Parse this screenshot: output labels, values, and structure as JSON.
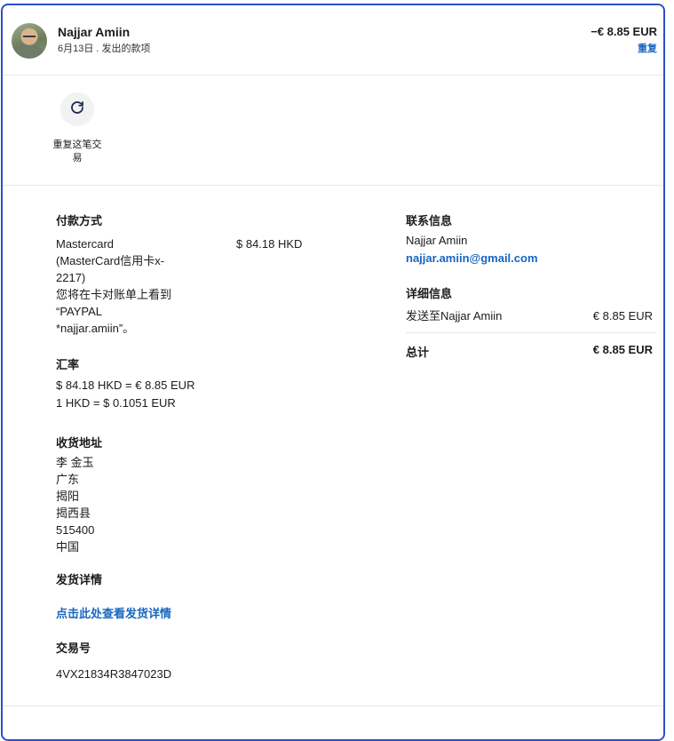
{
  "header": {
    "name": "Najjar Amiin",
    "subtitle": "6月13日 . 发出的款项",
    "amount": "−€ 8.85 EUR",
    "repeat_link": "重复"
  },
  "action": {
    "icon": "refresh-icon",
    "label": "重复这笔交易"
  },
  "payment": {
    "title": "付款方式",
    "method_lines": [
      "Mastercard",
      "(MasterCard信用卡x-",
      "2217)",
      "您将在卡对账单上看到",
      "“PAYPAL",
      "*najjar.amiin”。"
    ],
    "amount": "$ 84.18 HKD"
  },
  "exchange": {
    "title": "汇率",
    "line1": "$ 84.18 HKD = € 8.85 EUR",
    "line2": "1 HKD = $ 0.1051 EUR"
  },
  "shipping_address": {
    "title": "收货地址",
    "lines": [
      "李 金玉",
      "广东",
      "揭阳",
      "揭西县",
      "515400",
      "中国"
    ]
  },
  "shipping_details": {
    "title": "发货详情",
    "link": "点击此处查看发货详情"
  },
  "transaction": {
    "title": "交易号",
    "id": "4VX21834R3847023D"
  },
  "contact": {
    "title": "联系信息",
    "name": "Najjar Amiin",
    "email": "najjar.amiin@gmail.com"
  },
  "details": {
    "title": "详细信息",
    "row_label": "发送至Najjar Amiin",
    "row_value": "€ 8.85 EUR",
    "total_label": "总计",
    "total_value": "€ 8.85 EUR"
  },
  "colors": {
    "accent": "#1766c0",
    "border": "#2b50c8"
  }
}
